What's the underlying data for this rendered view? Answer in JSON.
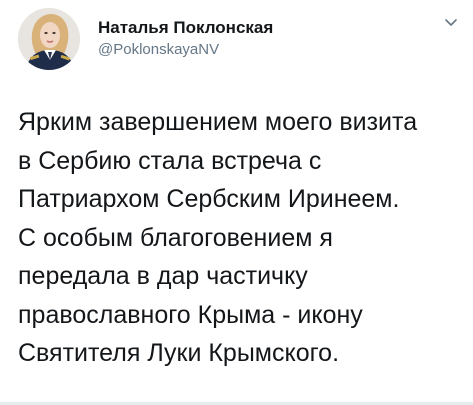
{
  "tweet": {
    "author": {
      "display_name": "Наталья Поклонская",
      "handle": "@PoklonskayaNV",
      "avatar_icon": "profile-photo"
    },
    "menu_icon": "chevron-down-icon",
    "text_lines": [
      "Ярким завершением моего визита",
      "в Сербию стала встреча с",
      "Патриархом Сербским Иринеем.",
      "С особым благоговением я",
      "передала в дар частичку",
      "православного Крыма - икону",
      "Святителя Луки Крымского."
    ],
    "colors": {
      "text": "#14171a",
      "secondary": "#657786"
    }
  }
}
